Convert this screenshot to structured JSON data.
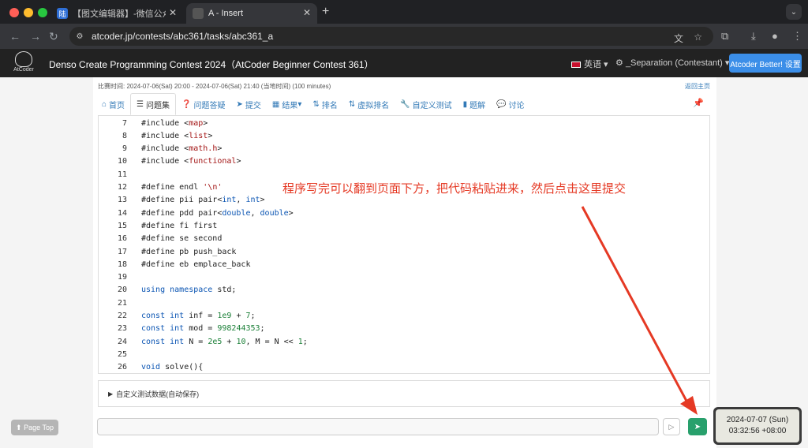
{
  "browser": {
    "tabs": [
      {
        "label": "【图文编辑器】-微信公众号图"
      },
      {
        "label": "A - Insert"
      }
    ],
    "favicon_text": "陆",
    "url": "atcoder.jp/contests/abc361/tasks/abc361_a"
  },
  "site": {
    "logo_text": "AtCoder",
    "contest_title": "Denso Create Programming Contest 2024（AtCoder Beginner Contest 361）",
    "language": "英语",
    "user": "_Separation (Contestant)",
    "better_button": "Atcoder Better! 设置"
  },
  "contest": {
    "time_line": "比赛时间: 2024-07-06(Sat) 20:00 - 2024-07-06(Sat) 21:40 (当地时间) (100 minutes)",
    "back_home": "返回主页",
    "nav": [
      {
        "label": "首页",
        "icon": "home-icon"
      },
      {
        "label": "问题集",
        "icon": "list-icon"
      },
      {
        "label": "问题答疑",
        "icon": "question-icon"
      },
      {
        "label": "提交",
        "icon": "send-icon"
      },
      {
        "label": "结果",
        "icon": "table-icon"
      },
      {
        "label": "排名",
        "icon": "sort-icon"
      },
      {
        "label": "虚拟排名",
        "icon": "sort-icon"
      },
      {
        "label": "自定义测试",
        "icon": "wrench-icon"
      },
      {
        "label": "题解",
        "icon": "book-icon"
      },
      {
        "label": "讨论",
        "icon": "chat-icon"
      }
    ]
  },
  "editor": {
    "lines": [
      {
        "n": "7",
        "code": "#include <map>"
      },
      {
        "n": "8",
        "code": "#include <list>"
      },
      {
        "n": "9",
        "code": "#include <math.h>"
      },
      {
        "n": "10",
        "code": "#include <functional>"
      },
      {
        "n": "11",
        "code": ""
      },
      {
        "n": "12",
        "code": "#define endl '\\n'"
      },
      {
        "n": "13",
        "code": "#define pii pair<int, int>"
      },
      {
        "n": "14",
        "code": "#define pdd pair<double, double>"
      },
      {
        "n": "15",
        "code": "#define fi first"
      },
      {
        "n": "16",
        "code": "#define se second"
      },
      {
        "n": "17",
        "code": "#define pb push_back"
      },
      {
        "n": "18",
        "code": "#define eb emplace_back"
      },
      {
        "n": "19",
        "code": ""
      },
      {
        "n": "20",
        "code": "using namespace std;"
      },
      {
        "n": "21",
        "code": ""
      },
      {
        "n": "22",
        "code": "const int inf = 1e9 + 7;"
      },
      {
        "n": "23",
        "code": "const int mod = 998244353;"
      },
      {
        "n": "24",
        "code": "const int N = 2e5 + 10, M = N << 1;"
      },
      {
        "n": "25",
        "code": ""
      },
      {
        "n": "26",
        "code": "void solve(){"
      }
    ]
  },
  "annotation": "程序写完可以翻到页面下方，把代码粘贴进来，然后点击这里提交",
  "custom_test_label": "自定义测试数据(自动保存)",
  "page_top_label": "Page Top",
  "clock": {
    "date": "2024-07-07 (Sun)",
    "time": "03:32:56 +08:00"
  },
  "colors": {
    "accent": "#3b8ee8",
    "submit": "#28a06c",
    "annotation": "#e53924"
  }
}
